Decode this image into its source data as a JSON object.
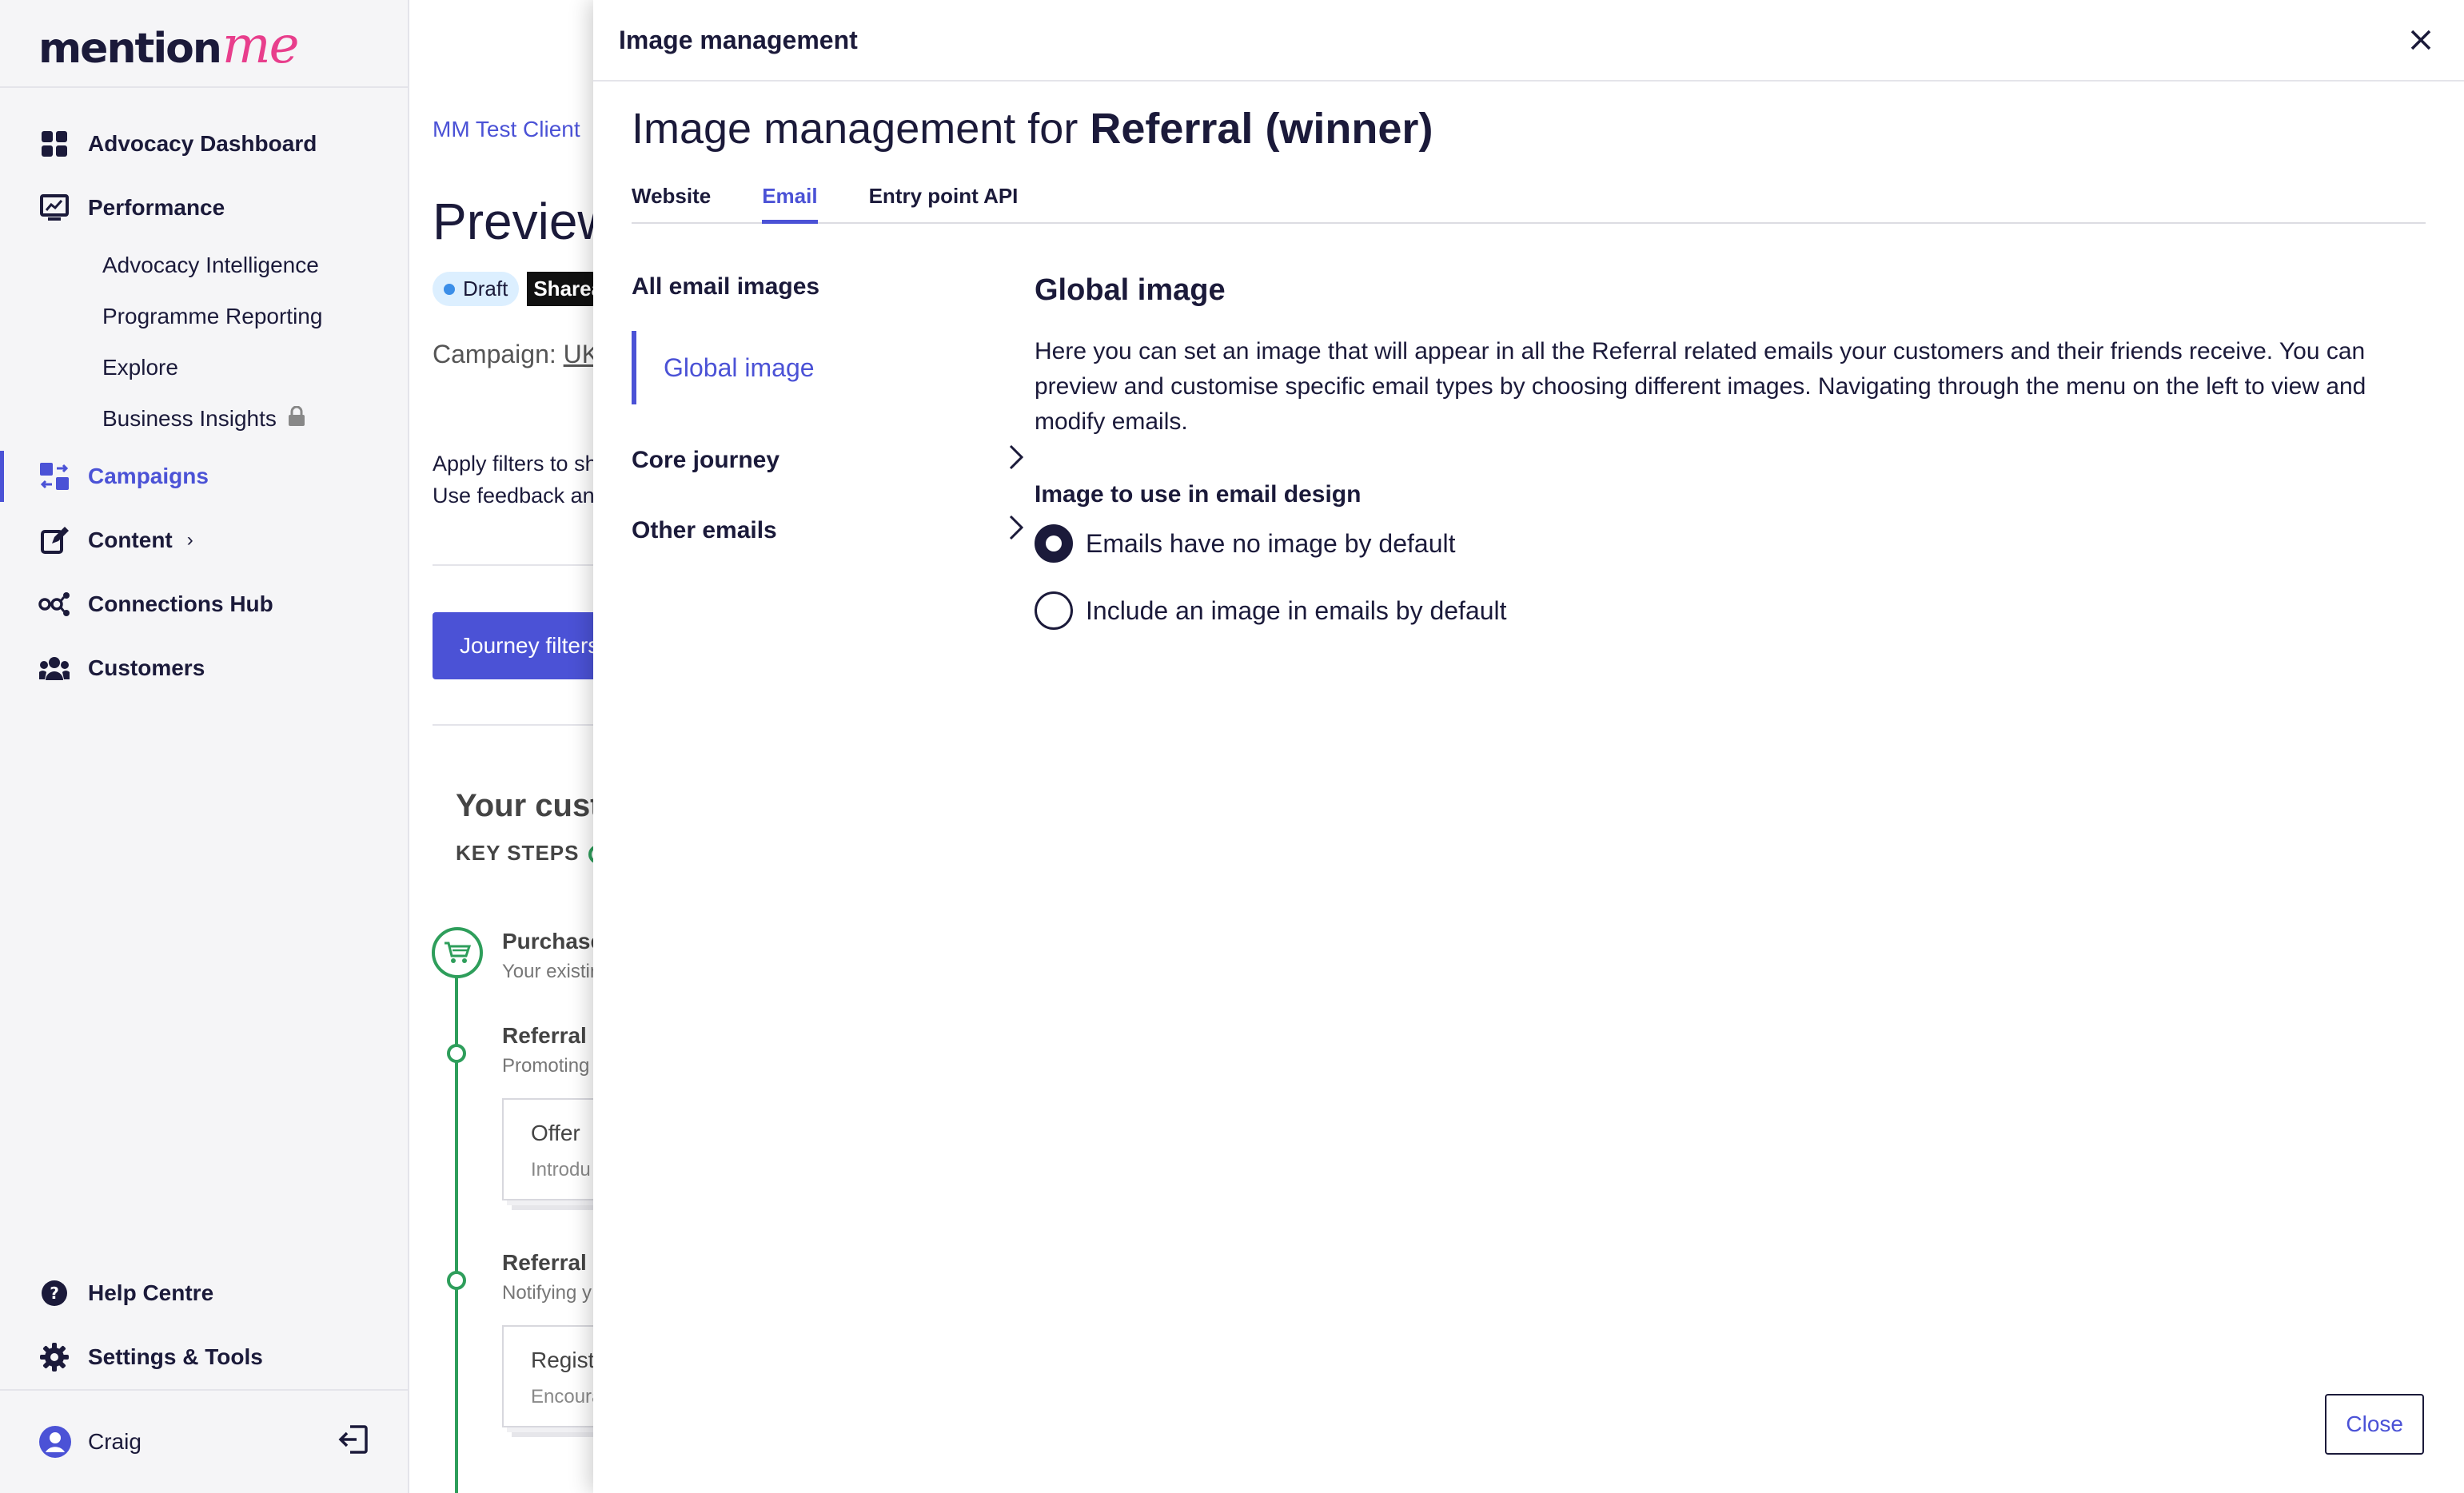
{
  "brand": {
    "logo_part1": "mention",
    "logo_part2": "me"
  },
  "sidebar": {
    "nav": [
      {
        "label": "Advocacy Dashboard"
      },
      {
        "label": "Performance"
      },
      {
        "label": "Advocacy Intelligence"
      },
      {
        "label": "Programme Reporting"
      },
      {
        "label": "Explore"
      },
      {
        "label": "Business Insights"
      },
      {
        "label": "Campaigns"
      },
      {
        "label": "Content"
      },
      {
        "label": "Connections Hub"
      },
      {
        "label": "Customers"
      }
    ],
    "bottom": [
      {
        "label": "Help Centre"
      },
      {
        "label": "Settings & Tools"
      }
    ],
    "user": {
      "name": "Craig"
    }
  },
  "background_page": {
    "breadcrumb": "MM Test Client",
    "title": "Preview",
    "badge_draft": "Draft",
    "badge_share": "Shareable",
    "campaign_label": "Campaign:",
    "campaign_value": "UK",
    "filters_line1": "Apply filters to sh",
    "filters_line2": "Use feedback an",
    "journey_button": "Journey filters",
    "customer_title": "Your custo",
    "key_steps": "KEY STEPS",
    "steps": [
      {
        "title": "Purchase",
        "sub": "Your existin"
      },
      {
        "title": "Referral c",
        "sub": "Promoting"
      },
      {
        "title": "Referral e",
        "sub": "Notifying y"
      }
    ],
    "cards": [
      {
        "title": "Offer",
        "sub": "Introdu"
      },
      {
        "title": "Regist",
        "sub": "Encoura"
      }
    ]
  },
  "drawer": {
    "header_title": "Image management",
    "title_prefix": "Image management for",
    "title_bold": "Referral (winner)",
    "tabs": [
      {
        "label": "Website"
      },
      {
        "label": "Email"
      },
      {
        "label": "Entry point API"
      }
    ],
    "menu": {
      "all_images": "All email images",
      "global_image": "Global image",
      "core_journey": "Core journey",
      "other_emails": "Other emails"
    },
    "pane": {
      "title": "Global image",
      "description": "Here you can set an image that will appear in all the Referral related emails your customers and their friends receive. You can preview and customise specific email types by choosing different images. Navigating through the menu on the left to view and modify emails.",
      "field_label": "Image to use in email design",
      "options": [
        {
          "label": "Emails have no image by default",
          "selected": true
        },
        {
          "label": "Include an image in emails by default",
          "selected": false
        }
      ]
    },
    "close_button": "Close"
  },
  "colors": {
    "accent": "#4b52d6",
    "brand_pink": "#e83e8c",
    "text": "#1b1a3a",
    "success": "#2e9e5b"
  }
}
